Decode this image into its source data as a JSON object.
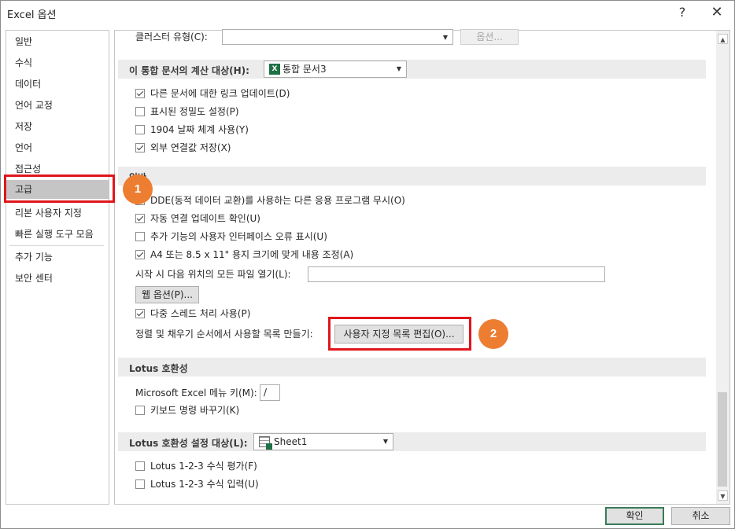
{
  "window": {
    "title": "Excel 옵션",
    "help_glyph": "?",
    "close_glyph": "✕"
  },
  "sidebar": {
    "items": [
      {
        "label": "일반"
      },
      {
        "label": "수식"
      },
      {
        "label": "데이터"
      },
      {
        "label": "언어 교정"
      },
      {
        "label": "저장"
      },
      {
        "label": "언어"
      },
      {
        "label": "접근성"
      },
      {
        "label": "고급",
        "selected": true
      },
      {
        "label": "리본 사용자 지정"
      },
      {
        "label": "빠른 실행 도구 모음"
      },
      {
        "label": "추가 기능"
      },
      {
        "label": "보안 센터"
      }
    ]
  },
  "top_row": {
    "label": "클러스터 유형(C):",
    "select_value": "",
    "button": "옵션..."
  },
  "calc_section": {
    "title": "이 통합 문서의 계산 대상(H):",
    "workbook": "통합 문서3",
    "workbook_icon": "X",
    "options": [
      {
        "label": "다른 문서에 대한 링크 업데이트(D)",
        "checked": true
      },
      {
        "label": "표시된 정밀도 설정(P)",
        "checked": false
      },
      {
        "label": "1904 날짜 체계 사용(Y)",
        "checked": false
      },
      {
        "label": "외부 연결값 저장(X)",
        "checked": true
      }
    ]
  },
  "general_section": {
    "title": "일반",
    "options": [
      {
        "label": "DDE(동적 데이터 교환)를 사용하는 다른 응용 프로그램 무시(O)",
        "checked": false
      },
      {
        "label": "자동 연결 업데이트 확인(U)",
        "checked": true
      },
      {
        "label": "추가 기능의 사용자 인터페이스 오류 표시(U)",
        "checked": false
      },
      {
        "label": "A4 또는 8.5 x 11\" 용지 크기에 맞게 내용 조정(A)",
        "checked": true
      }
    ],
    "startup_label": "시작 시 다음 위치의 모든 파일 열기(L):",
    "startup_value": "",
    "web_options_button": "웹 옵션(P)...",
    "multithread": {
      "label": "다중 스레드 처리 사용(P)",
      "checked": true
    },
    "custom_list_label": "정렬 및 채우기 순서에서 사용할 목록 만들기:",
    "custom_list_button": "사용자 지정 목록 편집(O)..."
  },
  "lotus_section": {
    "title": "Lotus 호환성",
    "menu_key_label": "Microsoft Excel 메뉴 키(M):",
    "menu_key_value": "/",
    "nav_keys": {
      "label": "키보드 명령 바꾸기(K)",
      "checked": false
    }
  },
  "lotus_settings_section": {
    "title": "Lotus 호환성 설정 대상(L):",
    "sheet": "Sheet1",
    "options": [
      {
        "label": "Lotus 1-2-3 수식 평가(F)",
        "checked": false
      },
      {
        "label": "Lotus 1-2-3 수식 입력(U)",
        "checked": false
      }
    ]
  },
  "footer": {
    "ok": "확인",
    "cancel": "취소"
  },
  "annotations": {
    "badge1": "1",
    "badge2": "2",
    "highlight_color": "#e0161b",
    "badge_color": "#ed7d31"
  }
}
